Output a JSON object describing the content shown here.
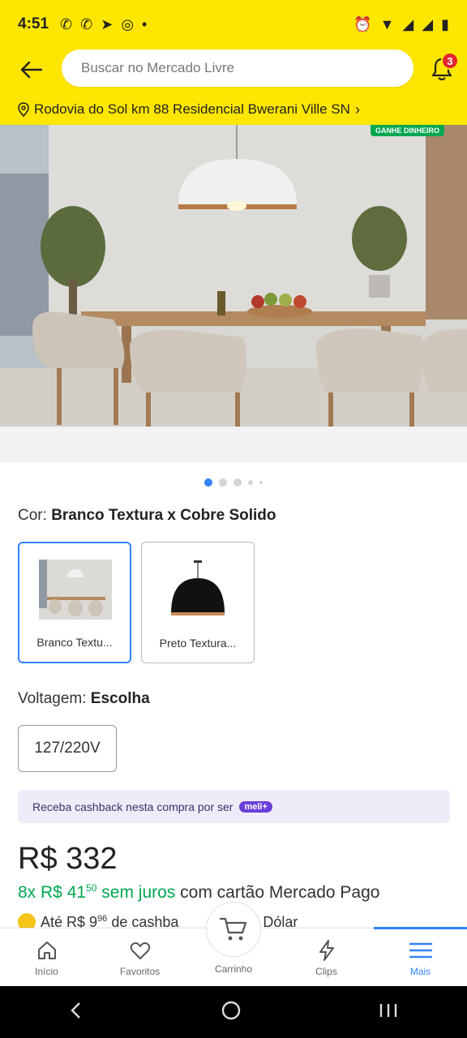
{
  "status_bar": {
    "time": "4:51"
  },
  "header": {
    "search_placeholder": "Buscar no Mercado Livre",
    "notification_count": "3"
  },
  "address": {
    "text": "Rodovia do Sol km 88 Residencial Bwerani Ville SN"
  },
  "image": {
    "badge": "GANHE DINHEIRO"
  },
  "color": {
    "label": "Cor:",
    "value": "Branco Textura x Cobre Solido",
    "variants": [
      {
        "label": "Branco Textu..."
      },
      {
        "label": "Preto Textura..."
      }
    ]
  },
  "voltage": {
    "label": "Voltagem:",
    "value": "Escolha",
    "option": "127/220V"
  },
  "cashback_banner": {
    "text": "Receba cashback nesta compra por ser",
    "badge": "meli+"
  },
  "price": {
    "main": "R$ 332",
    "installments_count": "8x R$ 41",
    "installments_cents": "50",
    "installments_suffix": "sem juros",
    "installments_card": "com cartão Mercado Pago",
    "cashback_line": "Até R$ 9",
    "cashback_cents": "96",
    "cashback_rest": "de cashba",
    "cashback_tail": "Meli Dólar"
  },
  "bottom_nav": {
    "items": [
      {
        "label": "Início"
      },
      {
        "label": "Favoritos"
      },
      {
        "label": "Carrinho"
      },
      {
        "label": "Clips"
      },
      {
        "label": "Mais"
      }
    ]
  },
  "colors": {
    "brand_yellow": "#FFE600",
    "accent_blue": "#3483fa",
    "green": "#00a650"
  }
}
